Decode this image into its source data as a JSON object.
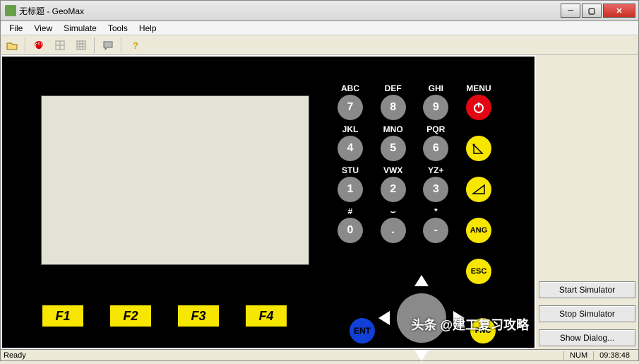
{
  "window": {
    "title": "无标题 - GeoMax"
  },
  "menu": {
    "file": "File",
    "view": "View",
    "simulate": "Simulate",
    "tools": "Tools",
    "help": "Help"
  },
  "fkeys": {
    "f1": "F1",
    "f2": "F2",
    "f3": "F3",
    "f4": "F4"
  },
  "keypad": {
    "row1": [
      {
        "label": "ABC",
        "key": "7"
      },
      {
        "label": "DEF",
        "key": "8"
      },
      {
        "label": "GHI",
        "key": "9"
      },
      {
        "label": "MENU",
        "icon": "power"
      }
    ],
    "row2": [
      {
        "label": "JKL",
        "key": "4"
      },
      {
        "label": "MNO",
        "key": "5"
      },
      {
        "label": "PQR",
        "key": "6"
      },
      {
        "label": "",
        "icon": "angle"
      }
    ],
    "row3": [
      {
        "label": "STU",
        "key": "1"
      },
      {
        "label": "VWX",
        "key": "2"
      },
      {
        "label": "YZ+",
        "key": "3"
      },
      {
        "label": "",
        "icon": "slope"
      }
    ],
    "row4": [
      {
        "label": "#",
        "key": "0"
      },
      {
        "label": "⌣",
        "key": "."
      },
      {
        "label": "*",
        "key": "-"
      },
      {
        "label": "",
        "key": "ANG"
      }
    ],
    "esc": "ESC",
    "ent": "ENT",
    "fnc": "FNC"
  },
  "side": {
    "start": "Start Simulator",
    "stop": "Stop Simulator",
    "dialog": "Show Dialog..."
  },
  "status": {
    "ready": "Ready",
    "num": "NUM",
    "time": "09:38:48"
  },
  "watermark": "头条 @建工复习攻略"
}
